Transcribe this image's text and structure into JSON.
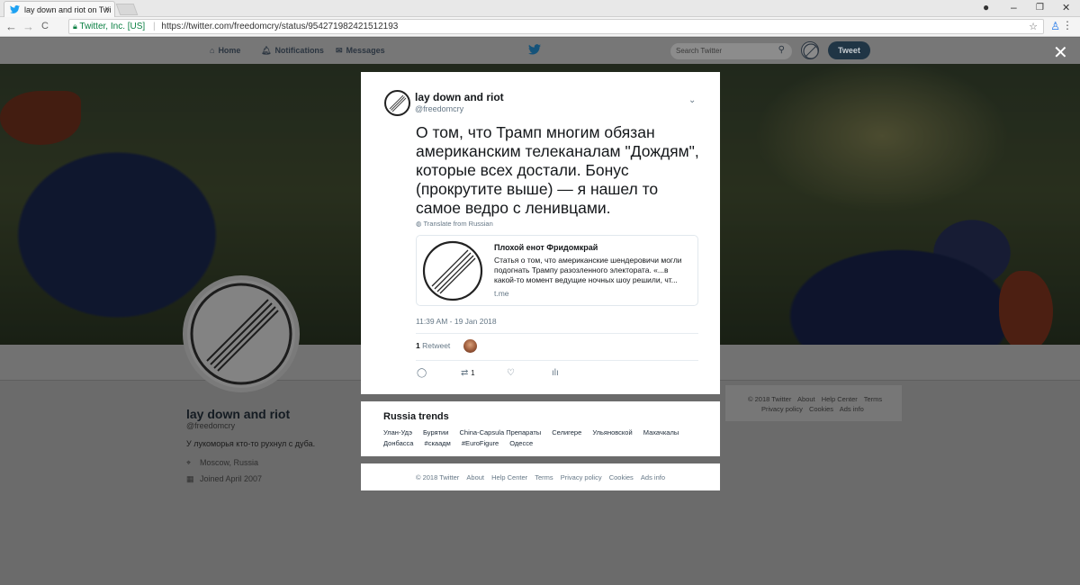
{
  "browser": {
    "tab_title": "lay down and riot on Twi",
    "tab_close": "×",
    "back": "←",
    "forward": "→",
    "reload": "C",
    "cert": "Twitter, Inc. [US]",
    "url": "https://twitter.com/freedomcry/status/954271982421512193",
    "minimize": "–",
    "maximize": "❐",
    "close": "✕"
  },
  "nav": {
    "home": "Home",
    "notifications": "Notifications",
    "messages": "Messages",
    "search_placeholder": "Search Twitter",
    "tweet_button": "Tweet"
  },
  "profile": {
    "name": "lay down and riot",
    "handle": "@freedomcry",
    "bio": "У лукоморья кто-то рухнул с дуба.",
    "location": "Moscow, Russia",
    "joined": "Joined April 2007"
  },
  "side_footer": [
    "© 2018 Twitter",
    "About",
    "Help Center",
    "Terms",
    "Privacy policy",
    "Cookies",
    "Ads info"
  ],
  "tweet": {
    "name": "lay down and riot",
    "handle": "@freedomcry",
    "text": "О том, что Трамп многим обязан американским телеканалам \"Дождям\", которые всех достали. Бонус (прокрутите выше) — я нашел то самое ведро с ленивцами.",
    "translate": "Translate from Russian",
    "card": {
      "title": "Плохой енот Фридомкрай",
      "description": "Статья о том, что американские шендеровичи могли подогнать Трампу разозленного электората. «...в какой-то момент ведущие ночных шоу решили, чт...",
      "domain": "t.me"
    },
    "timestamp": "11:39 AM - 19 Jan 2018",
    "retweet_count": "1",
    "retweet_label": "Retweet",
    "action_retweet_count": "1"
  },
  "trends": {
    "title": "Russia trends",
    "row1": [
      "Улан-Удэ",
      "Бурятии",
      "China-Capsula Препараты",
      "Селигере",
      "Ульяновской",
      "Махачкалы"
    ],
    "row2": [
      "Донбасса",
      "#скаадм",
      "#EuroFigure",
      "Одессе"
    ]
  },
  "modal_footer": [
    "© 2018 Twitter",
    "About",
    "Help Center",
    "Terms",
    "Privacy policy",
    "Cookies",
    "Ads info"
  ],
  "colors": {
    "overlay": "#6b6b6b",
    "twitter_blue": "#1da1f2",
    "text_primary": "#14171a",
    "text_secondary": "#657786"
  }
}
